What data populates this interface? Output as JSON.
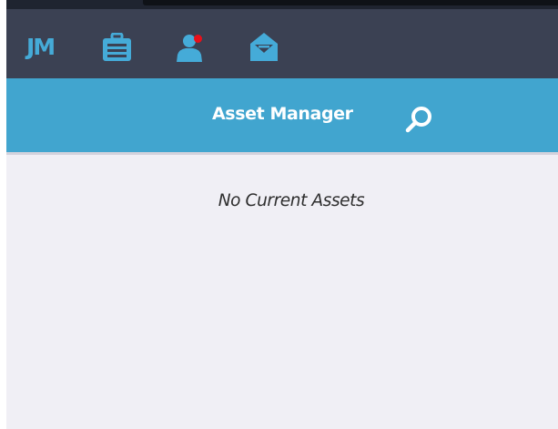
{
  "header": {
    "logo_text": "JM",
    "icons": [
      {
        "name": "briefcase-icon"
      },
      {
        "name": "user-icon",
        "has_notification": true
      },
      {
        "name": "inbox-icon"
      }
    ]
  },
  "title_bar": {
    "title": "Asset Manager",
    "search_icon": "search-icon"
  },
  "main": {
    "empty_message": "No Current Assets"
  },
  "colors": {
    "icon_bar_bg": "#3b4153",
    "accent": "#41a5cf",
    "icon_color": "#45abd8",
    "notification": "#e8101a",
    "content_bg": "#f0eff5"
  }
}
